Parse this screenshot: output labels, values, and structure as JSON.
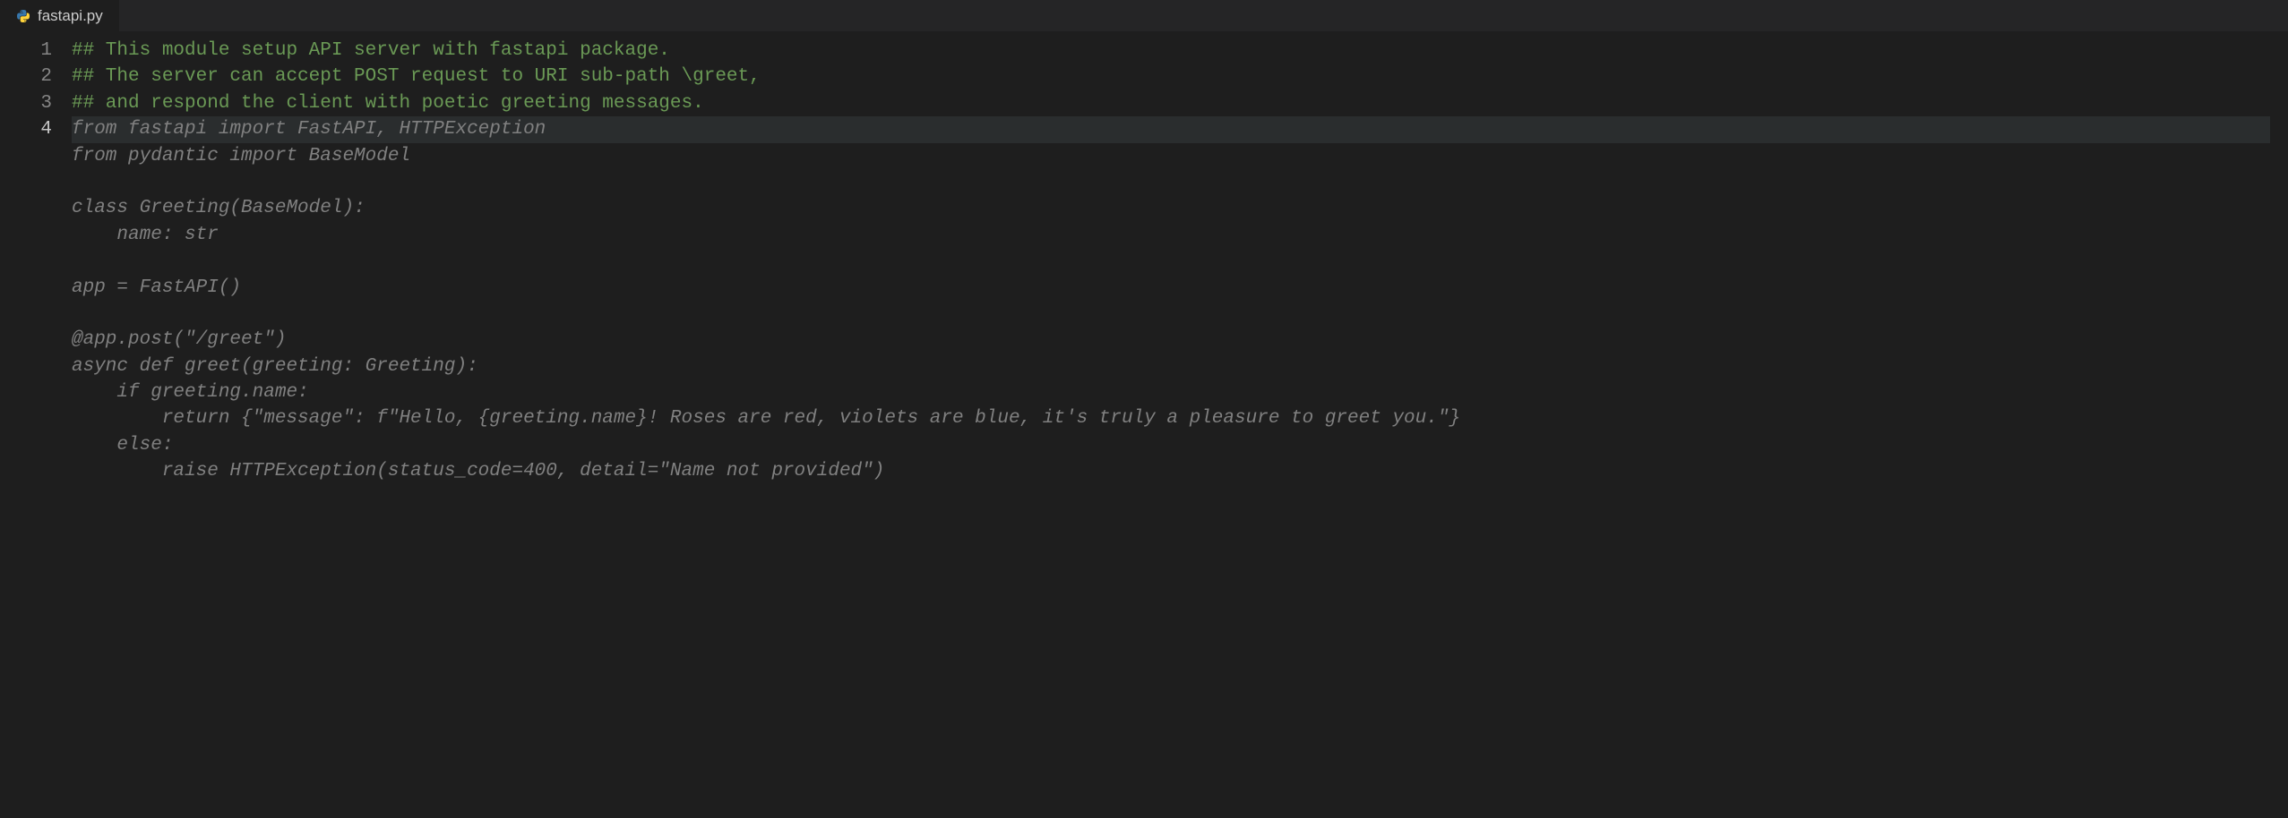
{
  "tab": {
    "filename": "fastapi.py",
    "icon": "python-file-icon"
  },
  "editor": {
    "active_line": 4,
    "gutter_lines": [
      "1",
      "2",
      "3",
      "4"
    ],
    "lines": [
      {
        "cls": "c-comment",
        "text": "## This module setup API server with fastapi package."
      },
      {
        "cls": "c-comment",
        "text": "## The server can accept POST request to URI sub-path \\greet,"
      },
      {
        "cls": "c-comment",
        "text": "## and respond the client with poetic greeting messages."
      },
      {
        "cls": "c-ghost active",
        "text": "from fastapi import FastAPI, HTTPException"
      },
      {
        "cls": "c-ghost",
        "text": "from pydantic import BaseModel"
      },
      {
        "cls": "c-ghost",
        "text": ""
      },
      {
        "cls": "c-ghost",
        "text": "class Greeting(BaseModel):"
      },
      {
        "cls": "c-ghost",
        "text": "    name: str"
      },
      {
        "cls": "c-ghost",
        "text": ""
      },
      {
        "cls": "c-ghost",
        "text": "app = FastAPI()"
      },
      {
        "cls": "c-ghost",
        "text": ""
      },
      {
        "cls": "c-ghost",
        "text": "@app.post(\"/greet\")"
      },
      {
        "cls": "c-ghost",
        "text": "async def greet(greeting: Greeting):"
      },
      {
        "cls": "c-ghost",
        "text": "    if greeting.name:"
      },
      {
        "cls": "c-ghost",
        "text": "        return {\"message\": f\"Hello, {greeting.name}! Roses are red, violets are blue, it's truly a pleasure to greet you.\"}"
      },
      {
        "cls": "c-ghost",
        "text": "    else:"
      },
      {
        "cls": "c-ghost",
        "text": "        raise HTTPException(status_code=400, detail=\"Name not provided\")"
      }
    ]
  }
}
